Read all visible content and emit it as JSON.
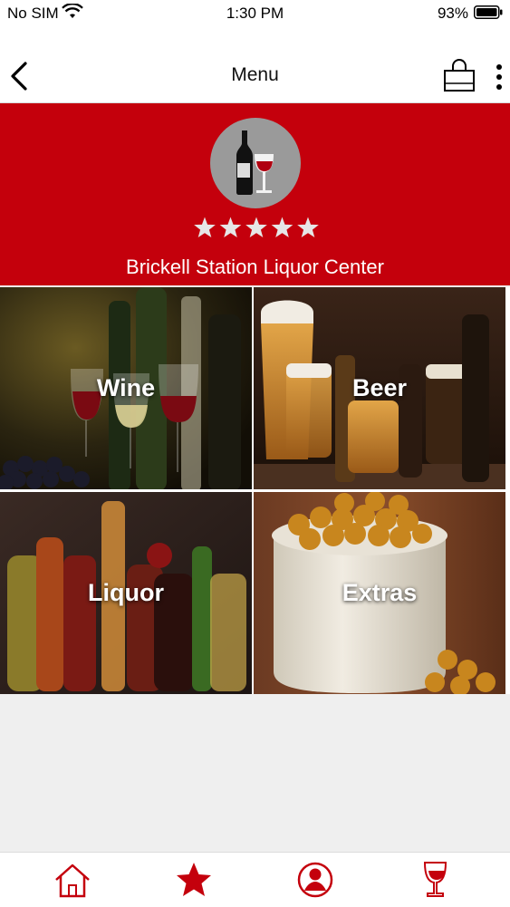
{
  "status_bar": {
    "carrier": "No SIM",
    "time": "1:30 PM",
    "battery": "93%"
  },
  "nav": {
    "title": "Menu"
  },
  "store": {
    "name": "Brickell Station Liquor Center",
    "rating": 5,
    "rating_max": 5
  },
  "categories": [
    {
      "label": "Wine"
    },
    {
      "label": "Beer"
    },
    {
      "label": "Liquor"
    },
    {
      "label": "Extras"
    }
  ],
  "tabbar": {
    "items": [
      "home-icon",
      "star-icon",
      "profile-icon",
      "wine-glass-icon"
    ]
  },
  "colors": {
    "brand": "#c4000c",
    "nav_background": "#ffffff",
    "page_background": "#efefef"
  }
}
